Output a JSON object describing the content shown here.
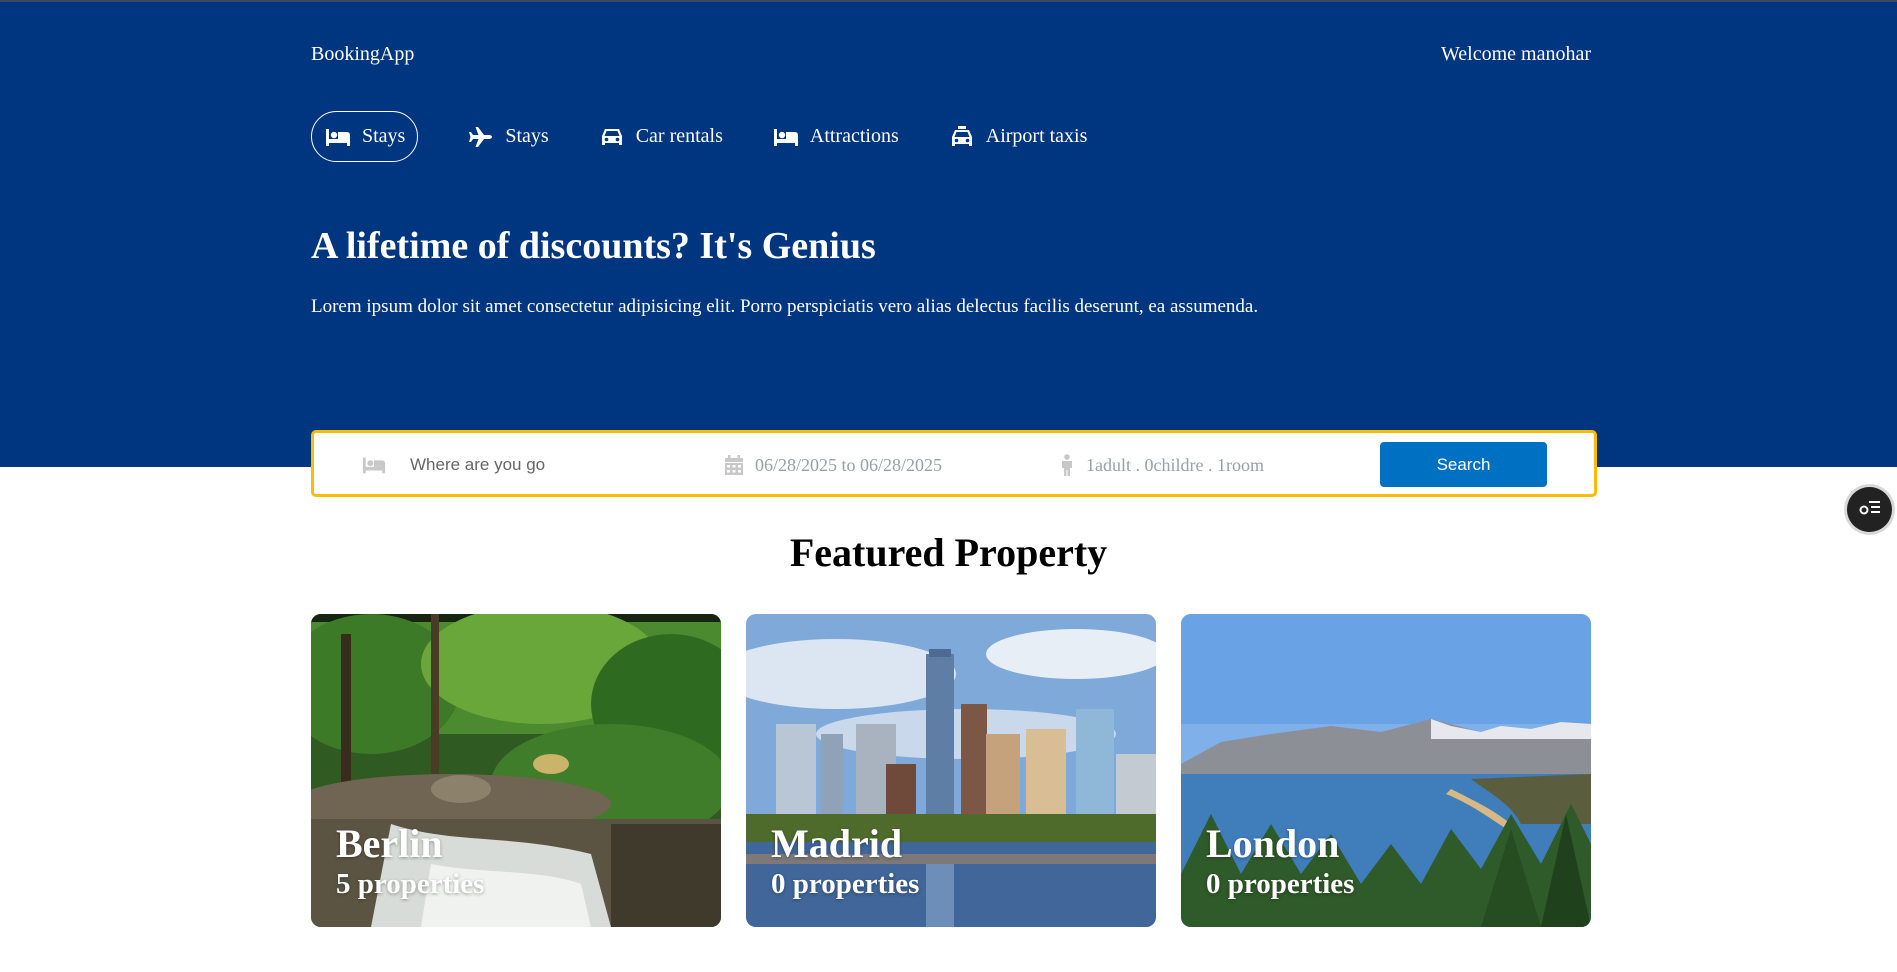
{
  "header": {
    "brand": "BookingApp",
    "welcome": "Welcome manohar"
  },
  "nav": [
    {
      "label": "Stays",
      "icon": "bed-icon",
      "active": true
    },
    {
      "label": "Stays",
      "icon": "plane-icon",
      "active": false
    },
    {
      "label": "Car rentals",
      "icon": "car-icon",
      "active": false
    },
    {
      "label": "Attractions",
      "icon": "bed-icon",
      "active": false
    },
    {
      "label": "Airport taxis",
      "icon": "taxi-icon",
      "active": false
    }
  ],
  "hero": {
    "title": "A lifetime of discounts? It's Genius",
    "description": "Lorem ipsum dolor sit amet consectetur adipisicing elit. Porro perspiciatis vero alias delectus facilis deserunt, ea assumenda."
  },
  "search": {
    "destination_placeholder": "Where are you go",
    "dates": "06/28/2025 to 06/28/2025",
    "guests": "1adult . 0childre . 1room",
    "button_label": "Search"
  },
  "featured": {
    "title": "Featured Property",
    "cards": [
      {
        "city": "Berlin",
        "count": "5 properties"
      },
      {
        "city": "Madrid",
        "count": "0 properties"
      },
      {
        "city": "London",
        "count": "0 properties"
      }
    ]
  },
  "colors": {
    "hero_bg": "#003580",
    "accent_border": "#febb02",
    "button_blue": "#0071c2"
  }
}
